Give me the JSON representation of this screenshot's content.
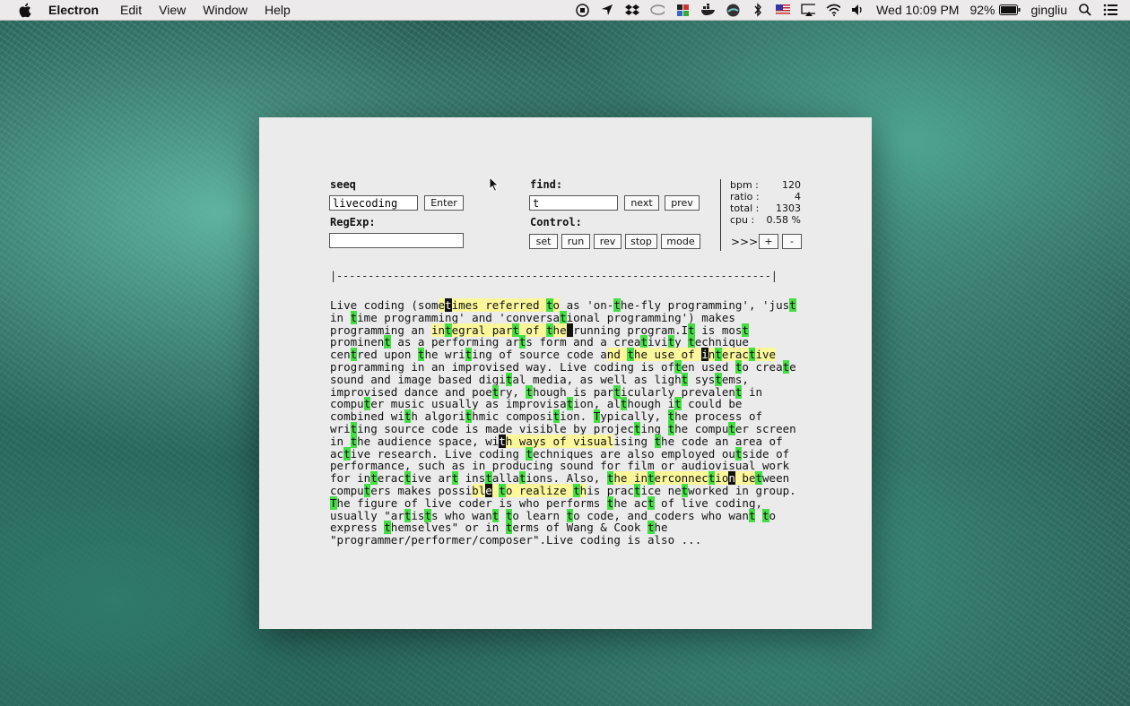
{
  "menubar": {
    "app_name": "Electron",
    "menus": [
      "Edit",
      "View",
      "Window",
      "Help"
    ],
    "datetime": "Wed 10:09 PM",
    "battery": "92%",
    "user": "gingliu"
  },
  "window": {
    "seeq": {
      "label": "seeq",
      "value": "livecoding",
      "enter_label": "Enter"
    },
    "regexp": {
      "label": "RegExp:",
      "value": ""
    },
    "find": {
      "label": "find:",
      "value": "t",
      "next_label": "next",
      "prev_label": "prev"
    },
    "control": {
      "label": "Control:",
      "buttons": {
        "set": "set",
        "run": "run",
        "rev": "rev",
        "stop": "stop",
        "mode": "mode"
      }
    },
    "stats": {
      "bpm_label": "bpm :",
      "bpm": "120",
      "ratio_label": "ratio :",
      "ratio": "4",
      "total_label": "total :",
      "total": "1303",
      "cpu_label": "cpu :",
      "cpu": "0.58 %"
    },
    "speed": {
      "prompt": ">>>",
      "plus": "+",
      "minus": "-"
    },
    "progress_bar": "|---------------------------------------------------------------------|",
    "text_lines": [
      "Live coding (sometimes referred to as 'on-the-fly programming', 'just",
      "in time programming' and 'conversational programming') makes",
      "programming an integral part of the running program.It is most",
      "prominent as a performing arts form and a creativity technique",
      "centred upon the writing of source code and the use of interactive",
      "programming in an improvised way. Live coding is often used to create",
      "sound and image based digital media, as well as light systems,",
      "improvised dance and poetry, though is particularly prevalent in",
      "computer music usually as improvisation, although it could be",
      "combined with algorithmic composition. Typically, the process of",
      "writing source code is made visible by projecting the computer screen",
      "in the audience space, with ways of visualising the code an area of",
      "active research. Live coding techniques are also employed outside of",
      "performance, such as in producing sound for film or audiovisual work",
      "for interactive art installations. Also, the interconnection between",
      "computers makes possible to realize this practice networked in group.",
      "The figure of live coder is who performs the act of live coding,",
      "usually \"artists who want to learn to code, and coders who want to",
      "express themselves\" or in terms of Wang & Cook the",
      "\"programmer/performer/composer\".Live coding is also ..."
    ],
    "highlights": {
      "green": "#44dd44",
      "yellow": "#fbf79a",
      "cursor": "#111111"
    }
  }
}
